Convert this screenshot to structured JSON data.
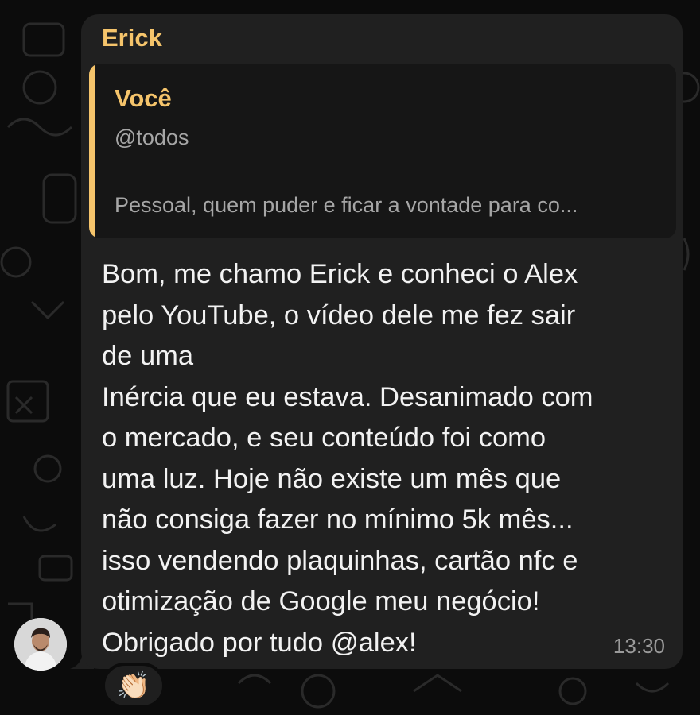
{
  "message": {
    "sender": "Erick",
    "quote": {
      "author": "Você",
      "line1": "@todos",
      "line2": "Pessoal, quem puder e ficar a vontade para co..."
    },
    "body_lines": [
      "Bom, me chamo Erick e conheci o Alex",
      "pelo YouTube, o vídeo dele me fez sair",
      "de uma",
      "Inércia que eu estava. Desanimado com",
      "o mercado, e seu conteúdo foi como",
      "uma luz. Hoje não existe um mês que",
      "não consiga fazer no mínimo 5k mês...",
      "isso vendendo plaquinhas, cartão nfc e",
      "otimização de Google meu negócio!",
      "Obrigado por tudo @alex!"
    ],
    "time": "13:30",
    "reaction": "👏🏻"
  },
  "colors": {
    "accent": "#f5c46b",
    "bubble": "#202020",
    "quote_bg": "#161616",
    "background": "#0c0c0c"
  },
  "icons": {
    "avatar": "avatar"
  }
}
